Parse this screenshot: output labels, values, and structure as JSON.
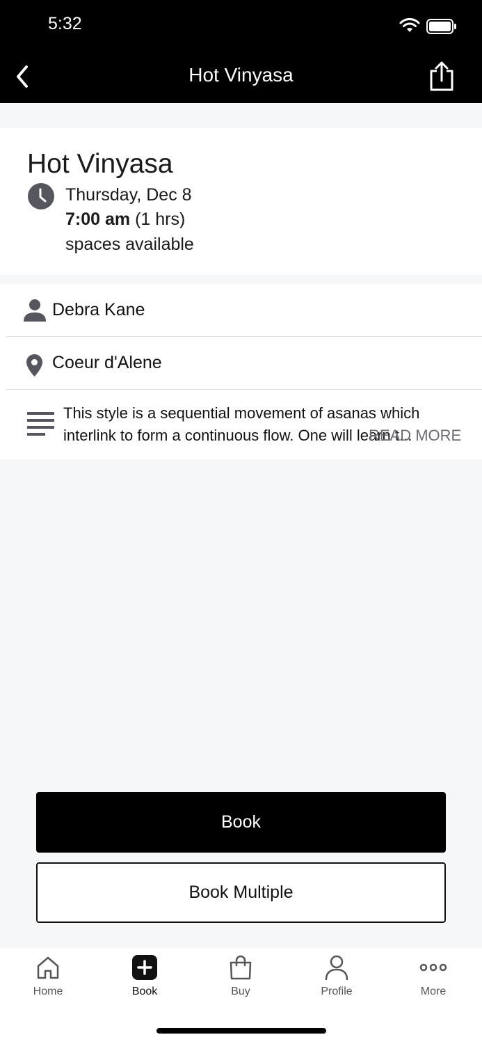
{
  "status_bar": {
    "time": "5:32"
  },
  "header": {
    "title": "Hot Vinyasa"
  },
  "class": {
    "title": "Hot Vinyasa",
    "date": "Thursday, Dec 8",
    "time": "7:00 am",
    "duration": "(1 hrs)",
    "spaces": "spaces available"
  },
  "details": {
    "instructor": "Debra Kane",
    "location": "Coeur d'Alene",
    "description": "This style is a sequential movement of asanas which interlink to form a continuous flow. One will learn t...",
    "read_more": "READ MORE"
  },
  "actions": {
    "book": "Book",
    "book_multiple": "Book Multiple"
  },
  "tabbar": {
    "items": [
      {
        "label": "Home",
        "icon": "home-icon"
      },
      {
        "label": "Book",
        "icon": "plus-square-icon"
      },
      {
        "label": "Buy",
        "icon": "bag-icon"
      },
      {
        "label": "Profile",
        "icon": "person-icon"
      },
      {
        "label": "More",
        "icon": "more-icon"
      }
    ]
  }
}
